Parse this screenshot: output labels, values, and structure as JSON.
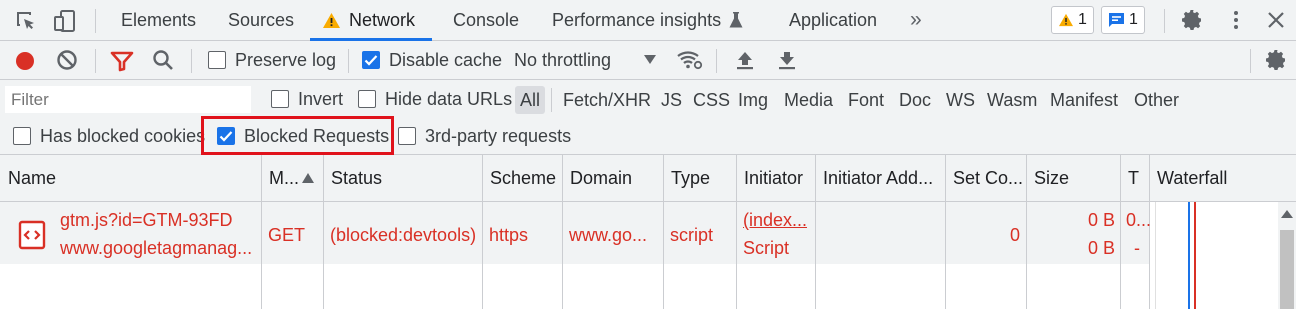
{
  "tabs": {
    "elements": "Elements",
    "sources": "Sources",
    "network": "Network",
    "console": "Console",
    "performance": "Performance insights",
    "application": "Application",
    "more": "»"
  },
  "badges": {
    "warnings": "1",
    "messages": "1"
  },
  "toolbar": {
    "preserve_log": "Preserve log",
    "disable_cache": "Disable cache",
    "throttling": "No throttling"
  },
  "filter": {
    "placeholder": "Filter",
    "invert": "Invert",
    "hide_data_urls": "Hide data URLs",
    "types": [
      "All",
      "Fetch/XHR",
      "JS",
      "CSS",
      "Img",
      "Media",
      "Font",
      "Doc",
      "WS",
      "Wasm",
      "Manifest",
      "Other"
    ],
    "has_blocked_cookies": "Has blocked cookies",
    "blocked_requests": "Blocked Requests",
    "third_party": "3rd-party requests"
  },
  "columns": [
    "Name",
    "M...",
    "Status",
    "Scheme",
    "Domain",
    "Type",
    "Initiator",
    "Initiator Add...",
    "Set Co...",
    "Size",
    "T",
    "Waterfall"
  ],
  "request": {
    "name": "gtm.js?id=GTM-93FD",
    "path": "www.googletagmanag...",
    "method": "GET",
    "status": "(blocked:devtools)",
    "scheme": "https",
    "domain": "www.go...",
    "type": "script",
    "initiator": "(index...",
    "initiator_type": "Script",
    "set_cookies": "0",
    "size": "0 B",
    "size2": "0 B",
    "time": "0...",
    "time2": "-"
  },
  "colors": {
    "accent": "#1a73e8",
    "error": "#d93025",
    "warning": "#f9ab00",
    "highlight_box": "#e0121b"
  }
}
